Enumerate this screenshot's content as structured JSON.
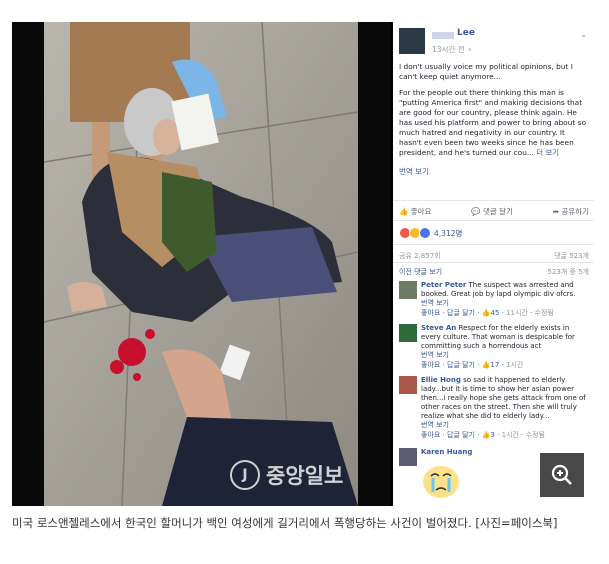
{
  "post": {
    "author": "Lee",
    "time": "13시간 전",
    "paragraph1": "I don't usually voice my political opinions, but I can't keep quiet anymore...",
    "paragraph2": "For the people out there thinking this man is \"putting America first\" and making decisions that are good for our country, please think again. He has used his platform and power to bring about so much hatred and negativity in our country. It hasn't even been two weeks since he has been president, and he's turned our cou...",
    "see_more": "더 보기",
    "translate": "번역 보기"
  },
  "actions": {
    "like": "좋아요",
    "comment": "댓글 달기",
    "share": "공유하기"
  },
  "reactions": {
    "count": "4,312명"
  },
  "stats": {
    "shares": "공유 2,857회",
    "comments": "댓글 523개"
  },
  "comments_header": {
    "previous": "이전 댓글 보기",
    "count": "523개 중 5개"
  },
  "comments": [
    {
      "name": "Peter Peter",
      "text": "The suspect was arrested and booked. Great job by lapd olympic div ofcrs.",
      "translate": "번역 보기",
      "like": "좋아요",
      "reply": "답글 달기",
      "likes": "45",
      "time": "11시간",
      "edited": "수정됨"
    },
    {
      "name": "Steve An",
      "text": "Respect for the elderly exists in every culture. That woman is despicable for committing such a horrendous act",
      "translate": "번역 보기",
      "like": "좋아요",
      "reply": "답글 달기",
      "likes": "17",
      "time": "1시간"
    },
    {
      "name": "Ellie Hong",
      "text": "so sad it happened to elderly lady...but it is time to show her asian power then...i really hope she gets attack from one of other races on the street. Then she will truly realize what she did to elderly lady...",
      "translate": "번역 보기",
      "like": "좋아요",
      "reply": "답글 달기",
      "likes": "3",
      "time": "1시간",
      "edited": "수정됨"
    },
    {
      "name": "Karen Huang"
    }
  ],
  "watermark": "중앙일보",
  "caption": "미국 로스앤젤레스에서 한국인 할머니가 백인 여성에게 길거리에서 폭행당하는 사건이 벌어졌다. [사진=페이스북]",
  "icons": {
    "zoom": "zoom-in-icon",
    "like": "thumbs-up-icon",
    "comment": "speech-bubble-icon",
    "share": "share-arrow-icon",
    "globe": "globe-icon"
  },
  "colors": {
    "link": "#365899",
    "blood": "#c8102e",
    "glove": "#7bb6e6"
  }
}
